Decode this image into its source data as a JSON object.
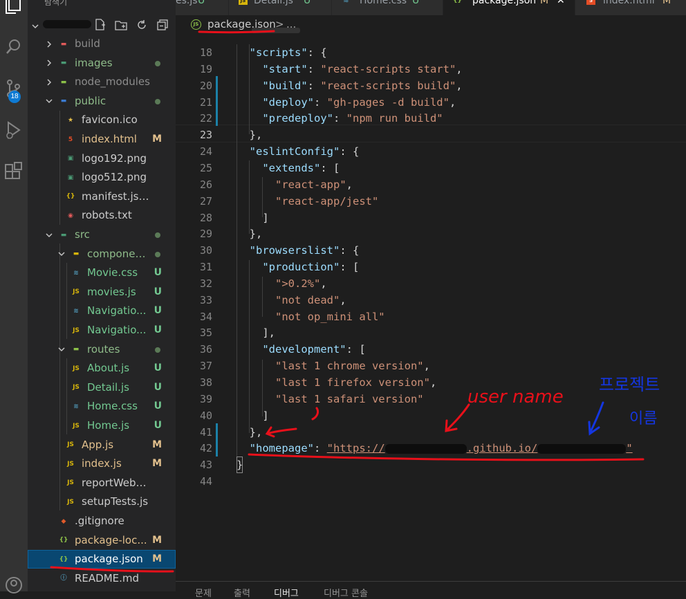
{
  "explorer": {
    "title": "탐색기",
    "root_actions": [
      "new-file-icon",
      "new-folder-icon",
      "refresh-icon",
      "collapse-icon"
    ],
    "items": [
      {
        "name": "build",
        "type": "folder",
        "status": ""
      },
      {
        "name": "images",
        "type": "folder",
        "status": ""
      },
      {
        "name": "node_modules",
        "type": "folder",
        "status": ""
      },
      {
        "name": "public",
        "type": "folder",
        "status": ""
      },
      {
        "name": "favicon.ico",
        "type": "file",
        "status": ""
      },
      {
        "name": "index.html",
        "type": "file",
        "status": "M"
      },
      {
        "name": "logo192.png",
        "type": "file",
        "status": ""
      },
      {
        "name": "logo512.png",
        "type": "file",
        "status": ""
      },
      {
        "name": "manifest.json",
        "type": "file",
        "status": ""
      },
      {
        "name": "robots.txt",
        "type": "file",
        "status": ""
      },
      {
        "name": "src",
        "type": "folder",
        "status": ""
      },
      {
        "name": "components",
        "type": "folder",
        "status": ""
      },
      {
        "name": "Movie.css",
        "type": "file",
        "status": "U"
      },
      {
        "name": "movies.js",
        "type": "file",
        "status": "U"
      },
      {
        "name": "Navigatio...",
        "type": "file",
        "status": "U"
      },
      {
        "name": "Navigatio...",
        "type": "file",
        "status": "U"
      },
      {
        "name": "routes",
        "type": "folder",
        "status": ""
      },
      {
        "name": "About.js",
        "type": "file",
        "status": "U"
      },
      {
        "name": "Detail.js",
        "type": "file",
        "status": "U"
      },
      {
        "name": "Home.css",
        "type": "file",
        "status": "U"
      },
      {
        "name": "Home.js",
        "type": "file",
        "status": "U"
      },
      {
        "name": "App.js",
        "type": "file",
        "status": "M"
      },
      {
        "name": "index.js",
        "type": "file",
        "status": "M"
      },
      {
        "name": "reportWebVitals.js",
        "type": "file",
        "status": ""
      },
      {
        "name": "setupTests.js",
        "type": "file",
        "status": ""
      },
      {
        "name": ".gitignore",
        "type": "file",
        "status": ""
      },
      {
        "name": "package-loc...",
        "type": "file",
        "status": "M"
      },
      {
        "name": "package.json",
        "type": "file",
        "status": "M"
      },
      {
        "name": "README.md",
        "type": "file",
        "status": ""
      }
    ]
  },
  "activity_bar": {
    "icons": [
      "explorer-icon",
      "search-icon",
      "source-control-icon",
      "run-debug-icon",
      "extensions-icon",
      "account-icon"
    ],
    "scm_badge": "18"
  },
  "tabs": [
    {
      "label": "es.js",
      "status": "U",
      "icon": "js-icon"
    },
    {
      "label": "Detail.js",
      "status": "U",
      "icon": "js-icon"
    },
    {
      "label": "Home.css",
      "status": "U",
      "icon": "css-icon"
    },
    {
      "label": "package.json",
      "status": "M",
      "icon": "json-icon",
      "active": true
    },
    {
      "label": "index.html",
      "status": "M",
      "icon": "html-icon"
    }
  ],
  "breadcrumb": {
    "file": "package.json",
    "separator": ">",
    "rest": "..."
  },
  "editor": {
    "lines": [
      {
        "n": "18",
        "parts": [
          {
            "t": "  ",
            "c": "p"
          },
          {
            "t": "\"scripts\"",
            "c": "k"
          },
          {
            "t": ": {",
            "c": "p"
          }
        ]
      },
      {
        "n": "19",
        "parts": [
          {
            "t": "    ",
            "c": "p"
          },
          {
            "t": "\"start\"",
            "c": "k"
          },
          {
            "t": ": ",
            "c": "p"
          },
          {
            "t": "\"react-scripts start\"",
            "c": "s"
          },
          {
            "t": ",",
            "c": "p"
          }
        ]
      },
      {
        "n": "20",
        "parts": [
          {
            "t": "    ",
            "c": "p"
          },
          {
            "t": "\"build\"",
            "c": "k"
          },
          {
            "t": ": ",
            "c": "p"
          },
          {
            "t": "\"react-scripts build\"",
            "c": "s"
          },
          {
            "t": ",",
            "c": "p"
          }
        ]
      },
      {
        "n": "21",
        "parts": [
          {
            "t": "    ",
            "c": "p"
          },
          {
            "t": "\"deploy\"",
            "c": "k"
          },
          {
            "t": ": ",
            "c": "p"
          },
          {
            "t": "\"gh-pages -d build\"",
            "c": "s"
          },
          {
            "t": ",",
            "c": "p"
          }
        ]
      },
      {
        "n": "22",
        "parts": [
          {
            "t": "    ",
            "c": "p"
          },
          {
            "t": "\"predeploy\"",
            "c": "k"
          },
          {
            "t": ": ",
            "c": "p"
          },
          {
            "t": "\"npm run build\"",
            "c": "s"
          }
        ]
      },
      {
        "n": "23",
        "parts": [
          {
            "t": "  },",
            "c": "p"
          }
        ]
      },
      {
        "n": "24",
        "parts": [
          {
            "t": "  ",
            "c": "p"
          },
          {
            "t": "\"eslintConfig\"",
            "c": "k"
          },
          {
            "t": ": {",
            "c": "p"
          }
        ]
      },
      {
        "n": "25",
        "parts": [
          {
            "t": "    ",
            "c": "p"
          },
          {
            "t": "\"extends\"",
            "c": "k"
          },
          {
            "t": ": [",
            "c": "p"
          }
        ]
      },
      {
        "n": "26",
        "parts": [
          {
            "t": "      ",
            "c": "p"
          },
          {
            "t": "\"react-app\"",
            "c": "s"
          },
          {
            "t": ",",
            "c": "p"
          }
        ]
      },
      {
        "n": "27",
        "parts": [
          {
            "t": "      ",
            "c": "p"
          },
          {
            "t": "\"react-app/jest\"",
            "c": "s"
          }
        ]
      },
      {
        "n": "28",
        "parts": [
          {
            "t": "    ]",
            "c": "p"
          }
        ]
      },
      {
        "n": "29",
        "parts": [
          {
            "t": "  },",
            "c": "p"
          }
        ]
      },
      {
        "n": "30",
        "parts": [
          {
            "t": "  ",
            "c": "p"
          },
          {
            "t": "\"browserslist\"",
            "c": "k"
          },
          {
            "t": ": {",
            "c": "p"
          }
        ]
      },
      {
        "n": "31",
        "parts": [
          {
            "t": "    ",
            "c": "p"
          },
          {
            "t": "\"production\"",
            "c": "k"
          },
          {
            "t": ": [",
            "c": "p"
          }
        ]
      },
      {
        "n": "32",
        "parts": [
          {
            "t": "      ",
            "c": "p"
          },
          {
            "t": "\">0.2%\"",
            "c": "s"
          },
          {
            "t": ",",
            "c": "p"
          }
        ]
      },
      {
        "n": "33",
        "parts": [
          {
            "t": "      ",
            "c": "p"
          },
          {
            "t": "\"not dead\"",
            "c": "s"
          },
          {
            "t": ",",
            "c": "p"
          }
        ]
      },
      {
        "n": "34",
        "parts": [
          {
            "t": "      ",
            "c": "p"
          },
          {
            "t": "\"not op_mini all\"",
            "c": "s"
          }
        ]
      },
      {
        "n": "35",
        "parts": [
          {
            "t": "    ],",
            "c": "p"
          }
        ]
      },
      {
        "n": "36",
        "parts": [
          {
            "t": "    ",
            "c": "p"
          },
          {
            "t": "\"development\"",
            "c": "k"
          },
          {
            "t": ": [",
            "c": "p"
          }
        ]
      },
      {
        "n": "37",
        "parts": [
          {
            "t": "      ",
            "c": "p"
          },
          {
            "t": "\"last 1 chrome version\"",
            "c": "s"
          },
          {
            "t": ",",
            "c": "p"
          }
        ]
      },
      {
        "n": "38",
        "parts": [
          {
            "t": "      ",
            "c": "p"
          },
          {
            "t": "\"last 1 firefox version\"",
            "c": "s"
          },
          {
            "t": ",",
            "c": "p"
          }
        ]
      },
      {
        "n": "39",
        "parts": [
          {
            "t": "      ",
            "c": "p"
          },
          {
            "t": "\"last 1 safari version\"",
            "c": "s"
          }
        ]
      },
      {
        "n": "40",
        "parts": [
          {
            "t": "    ]",
            "c": "p"
          }
        ]
      },
      {
        "n": "41",
        "parts": [
          {
            "t": "  },",
            "c": "p"
          }
        ]
      },
      {
        "n": "42",
        "parts": [
          {
            "t": "  ",
            "c": "p"
          },
          {
            "t": "\"homepage\"",
            "c": "k"
          },
          {
            "t": ": ",
            "c": "p"
          },
          {
            "t": "\"https://",
            "c": "s"
          },
          {
            "t": "__REDACT1__",
            "c": "r"
          },
          {
            "t": ".github.io/",
            "c": "s"
          },
          {
            "t": "__REDACT2__",
            "c": "r"
          },
          {
            "t": "\"",
            "c": "s"
          }
        ]
      },
      {
        "n": "43",
        "parts": [
          {
            "t": "}",
            "c": "p"
          }
        ]
      },
      {
        "n": "44",
        "parts": []
      }
    ]
  },
  "annotations": {
    "username": "user name",
    "project_line1": "프로젝트",
    "project_line2": "이름"
  },
  "panel": {
    "tabs": [
      "문제",
      "출력",
      "디버그",
      "디버그 콘솔"
    ]
  },
  "colors": {
    "accent": "#0e7ad3",
    "annotation_red": "#e8101a",
    "annotation_blue": "#1436e0",
    "string": "#ce9178",
    "key": "#9cdcfe"
  }
}
